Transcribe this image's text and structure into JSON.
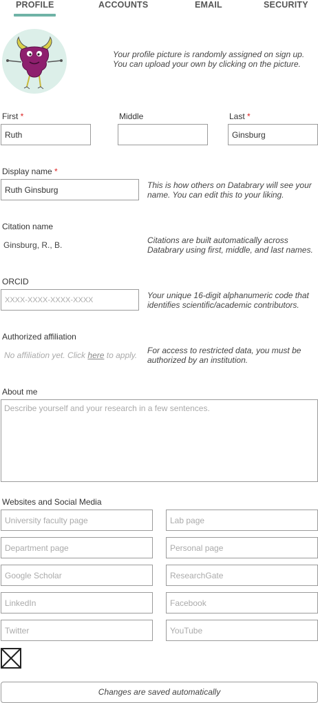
{
  "tabs": [
    {
      "label": "PROFILE",
      "active": true
    },
    {
      "label": "ACCOUNTS",
      "active": false
    },
    {
      "label": "EMAIL",
      "active": false
    },
    {
      "label": "SECURITY",
      "active": false
    }
  ],
  "avatar": {
    "hint_line1": "Your profile picture is randomly assigned on sign up.",
    "hint_line2": "You can upload your own by clicking on the picture."
  },
  "name": {
    "first_label": "First",
    "middle_label": "Middle",
    "last_label": "Last",
    "required_mark": "*",
    "first_value": "Ruth",
    "middle_value": "",
    "last_value": "Ginsburg"
  },
  "display_name": {
    "label": "Display name",
    "value": "Ruth Ginsburg",
    "hint_line1": "This is how others on Databrary will see your",
    "hint_line2": "name. You can edit this to your liking."
  },
  "citation": {
    "label": "Citation name",
    "value": "Ginsburg, R., B.",
    "hint_line1": "Citations are built automatically across",
    "hint_line2": "Databrary using first, middle, and last names."
  },
  "orcid": {
    "label": "ORCID",
    "placeholder": "XXXX-XXXX-XXXX-XXXX",
    "hint_line1": "Your unique 16-digit alphanumeric code that",
    "hint_line2": "identifies scientific/academic contributors."
  },
  "affiliation": {
    "label": "Authorized affiliation",
    "text_before": "No affiliation yet. Click ",
    "link": "here",
    "text_after": " to apply.",
    "hint_line1": "For access to restricted data, you must be",
    "hint_line2": "authorized by an institution."
  },
  "about": {
    "label": "About me",
    "placeholder": "Describe yourself and your research in a few sentences."
  },
  "websites": {
    "label": "Websites and Social Media",
    "university": "University faculty page",
    "lab": "Lab page",
    "department": "Department page",
    "personal": "Personal page",
    "scholar": "Google Scholar",
    "researchgate": "ResearchGate",
    "linkedin": "LinkedIn",
    "facebook": "Facebook",
    "twitter": "Twitter",
    "youtube": "YouTube"
  },
  "footer": {
    "saved_text": "Changes are saved automatically"
  },
  "colors": {
    "accent": "#6fb3a6",
    "required": "#dd2222",
    "avatar_bg": "#dcefe9",
    "border": "#9a9a9a"
  }
}
